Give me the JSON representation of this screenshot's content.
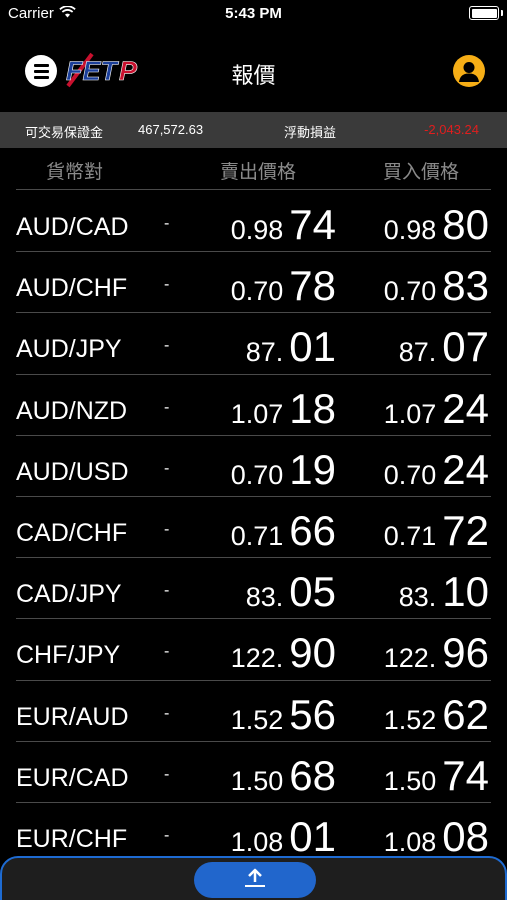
{
  "status_bar": {
    "carrier": "Carrier",
    "time": "5:43 PM"
  },
  "nav": {
    "title": "報價",
    "logo_text": "FETP"
  },
  "summary": {
    "margin_label": "可交易保證金",
    "margin_value": "467,572.63",
    "pl_label": "浮動損益",
    "pl_value": "-2,043.24",
    "pl_color": "#e01e1e"
  },
  "table": {
    "headers": {
      "pair": "貨幣對",
      "sell": "賣出價格",
      "buy": "買入價格"
    },
    "rows": [
      {
        "pair": "AUD/CAD",
        "dash": "-",
        "sell_small": "0.98",
        "sell_big": "74",
        "buy_small": "0.98",
        "buy_big": "80"
      },
      {
        "pair": "AUD/CHF",
        "dash": "-",
        "sell_small": "0.70",
        "sell_big": "78",
        "buy_small": "0.70",
        "buy_big": "83"
      },
      {
        "pair": "AUD/JPY",
        "dash": "-",
        "sell_small": "87.",
        "sell_big": "01",
        "buy_small": "87.",
        "buy_big": "07"
      },
      {
        "pair": "AUD/NZD",
        "dash": "-",
        "sell_small": "1.07",
        "sell_big": "18",
        "buy_small": "1.07",
        "buy_big": "24"
      },
      {
        "pair": "AUD/USD",
        "dash": "-",
        "sell_small": "0.70",
        "sell_big": "19",
        "buy_small": "0.70",
        "buy_big": "24"
      },
      {
        "pair": "CAD/CHF",
        "dash": "-",
        "sell_small": "0.71",
        "sell_big": "66",
        "buy_small": "0.71",
        "buy_big": "72"
      },
      {
        "pair": "CAD/JPY",
        "dash": "-",
        "sell_small": "83.",
        "sell_big": "05",
        "buy_small": "83.",
        "buy_big": "10"
      },
      {
        "pair": "CHF/JPY",
        "dash": "-",
        "sell_small": "122.",
        "sell_big": "90",
        "buy_small": "122.",
        "buy_big": "96"
      },
      {
        "pair": "EUR/AUD",
        "dash": "-",
        "sell_small": "1.52",
        "sell_big": "56",
        "buy_small": "1.52",
        "buy_big": "62"
      },
      {
        "pair": "EUR/CAD",
        "dash": "-",
        "sell_small": "1.50",
        "sell_big": "68",
        "buy_small": "1.50",
        "buy_big": "74"
      },
      {
        "pair": "EUR/CHF",
        "dash": "-",
        "sell_small": "1.08",
        "sell_big": "01",
        "buy_small": "1.08",
        "buy_big": "08"
      }
    ]
  },
  "icons": {
    "menu": "menu-icon",
    "user": "user-icon",
    "wifi": "wifi-icon",
    "battery": "battery-icon",
    "expand": "arrow-up-icon"
  },
  "colors": {
    "accent": "#2166cc",
    "user_icon": "#f6ae16",
    "negative": "#e01e1e"
  }
}
